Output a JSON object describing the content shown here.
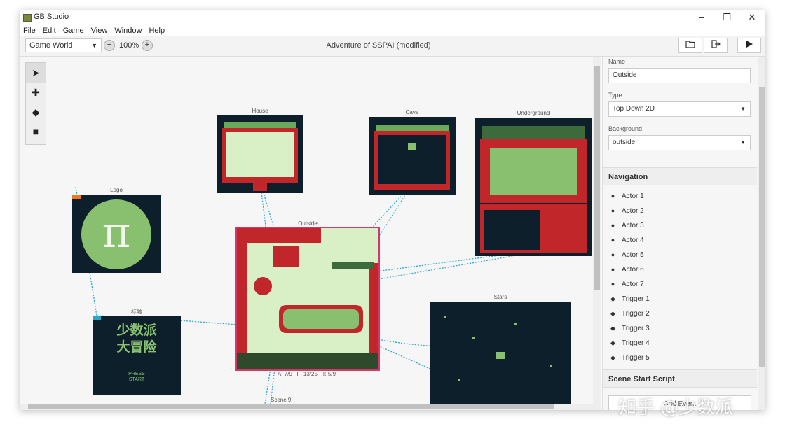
{
  "window": {
    "title": "GB Studio"
  },
  "menu": [
    "File",
    "Edit",
    "Game",
    "View",
    "Window",
    "Help"
  ],
  "toolbar": {
    "view_select": "Game World",
    "zoom": "100%",
    "project_title": "Adventure of SSPAI (modified)"
  },
  "scenes": {
    "house": "House",
    "cave": "Cave",
    "underground": "Underground",
    "logo": "Logo",
    "outside": "Outside",
    "title": "标题",
    "stars": "Stars",
    "scene9": "Scene 9",
    "title_art_line1": "少数派",
    "title_art_line2": "大冒险",
    "press": "PRESS",
    "start": "START",
    "outside_stats": "A: 7/9   F: 13/25   T: 5/9"
  },
  "sidebar": {
    "name_label": "Name",
    "name_value": "Outside",
    "type_label": "Type",
    "type_value": "Top Down 2D",
    "bg_label": "Background",
    "bg_value": "outside",
    "navigation_heading": "Navigation",
    "nav_items": [
      "Actor 1",
      "Actor 2",
      "Actor 3",
      "Actor 4",
      "Actor 5",
      "Actor 6",
      "Actor 7",
      "Trigger 1",
      "Trigger 2",
      "Trigger 3",
      "Trigger 4",
      "Trigger 5"
    ],
    "script_heading": "Scene Start Script",
    "add_event": "Add Event"
  },
  "watermark": "知乎 @少数派",
  "colors": {
    "scene_dark": "#0d1f2a",
    "brick": "#c0262a",
    "grass": "#d9f0c6",
    "green": "#88c070",
    "link": "#2aa6c9",
    "selection": "#d2386a"
  }
}
